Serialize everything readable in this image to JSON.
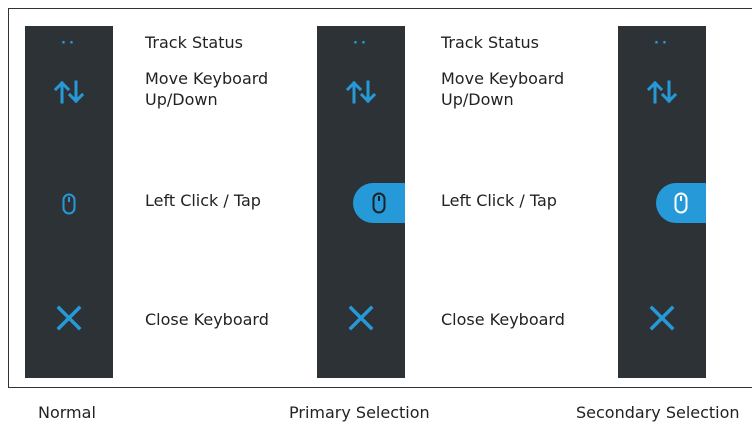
{
  "accent_color": "#2699d9",
  "bar_color": "#2d3236",
  "panels": [
    {
      "caption": "Normal",
      "state": "normal",
      "track_status_dots": "··",
      "labels": {
        "track_status": "Track Status",
        "move_keyboard": "Move Keyboard Up/Down",
        "left_click": "Left Click / Tap",
        "close_keyboard": "Close Keyboard"
      },
      "icons": {
        "track": "track-status-dots-icon",
        "move": "up-down-arrows-icon",
        "click": "mouse-icon",
        "close": "close-x-icon"
      }
    },
    {
      "caption": "Primary Selection",
      "state": "primary",
      "track_status_dots": "··",
      "labels": {
        "track_status": "Track Status",
        "move_keyboard": "Move Keyboard Up/Down",
        "left_click": "Left Click / Tap",
        "close_keyboard": "Close Keyboard"
      },
      "icons": {
        "track": "track-status-dots-icon",
        "move": "up-down-arrows-icon",
        "click": "mouse-icon",
        "close": "close-x-icon"
      }
    },
    {
      "caption": "Secondary Selection",
      "state": "secondary",
      "track_status_dots": "··",
      "icons": {
        "track": "track-status-dots-icon",
        "move": "up-down-arrows-icon",
        "click": "mouse-icon",
        "close": "close-x-icon"
      }
    }
  ]
}
